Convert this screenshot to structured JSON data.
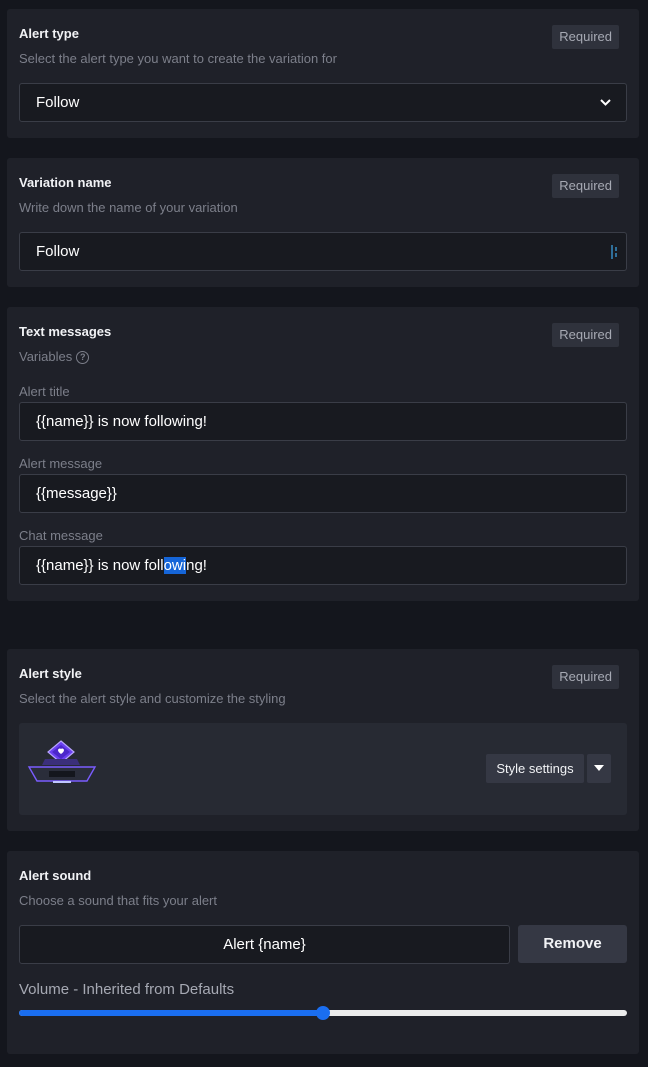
{
  "alert_type": {
    "title": "Alert type",
    "description": "Select the alert type you want to create the variation for",
    "badge": "Required",
    "selected": "Follow"
  },
  "variation_name": {
    "title": "Variation name",
    "description": "Write down the name of your variation",
    "badge": "Required",
    "value": "Follow"
  },
  "text_messages": {
    "title": "Text messages",
    "badge": "Required",
    "variables_label": "Variables",
    "alert_title": {
      "label": "Alert title",
      "value": "{{name}} is now following!"
    },
    "alert_message": {
      "label": "Alert message",
      "value": "{{message}}"
    },
    "chat_message": {
      "label": "Chat message",
      "value_before": "{{name}} is now foll",
      "value_selected": "owi",
      "value_after": "ng!"
    }
  },
  "alert_style": {
    "title": "Alert style",
    "description": "Select the alert style and customize the styling",
    "badge": "Required",
    "settings_button": "Style settings",
    "preview_icon": "heart-podium-icon"
  },
  "alert_sound": {
    "title": "Alert sound",
    "description": "Choose a sound that fits your alert",
    "sound_name": "Alert {name}",
    "remove_button": "Remove",
    "volume_label": "Volume - Inherited from Defaults",
    "volume_fraction": 0.5
  },
  "colors": {
    "background": "#14161d",
    "card": "#1f2129",
    "accent": "#1a6ef0",
    "selection": "#1565d8"
  }
}
